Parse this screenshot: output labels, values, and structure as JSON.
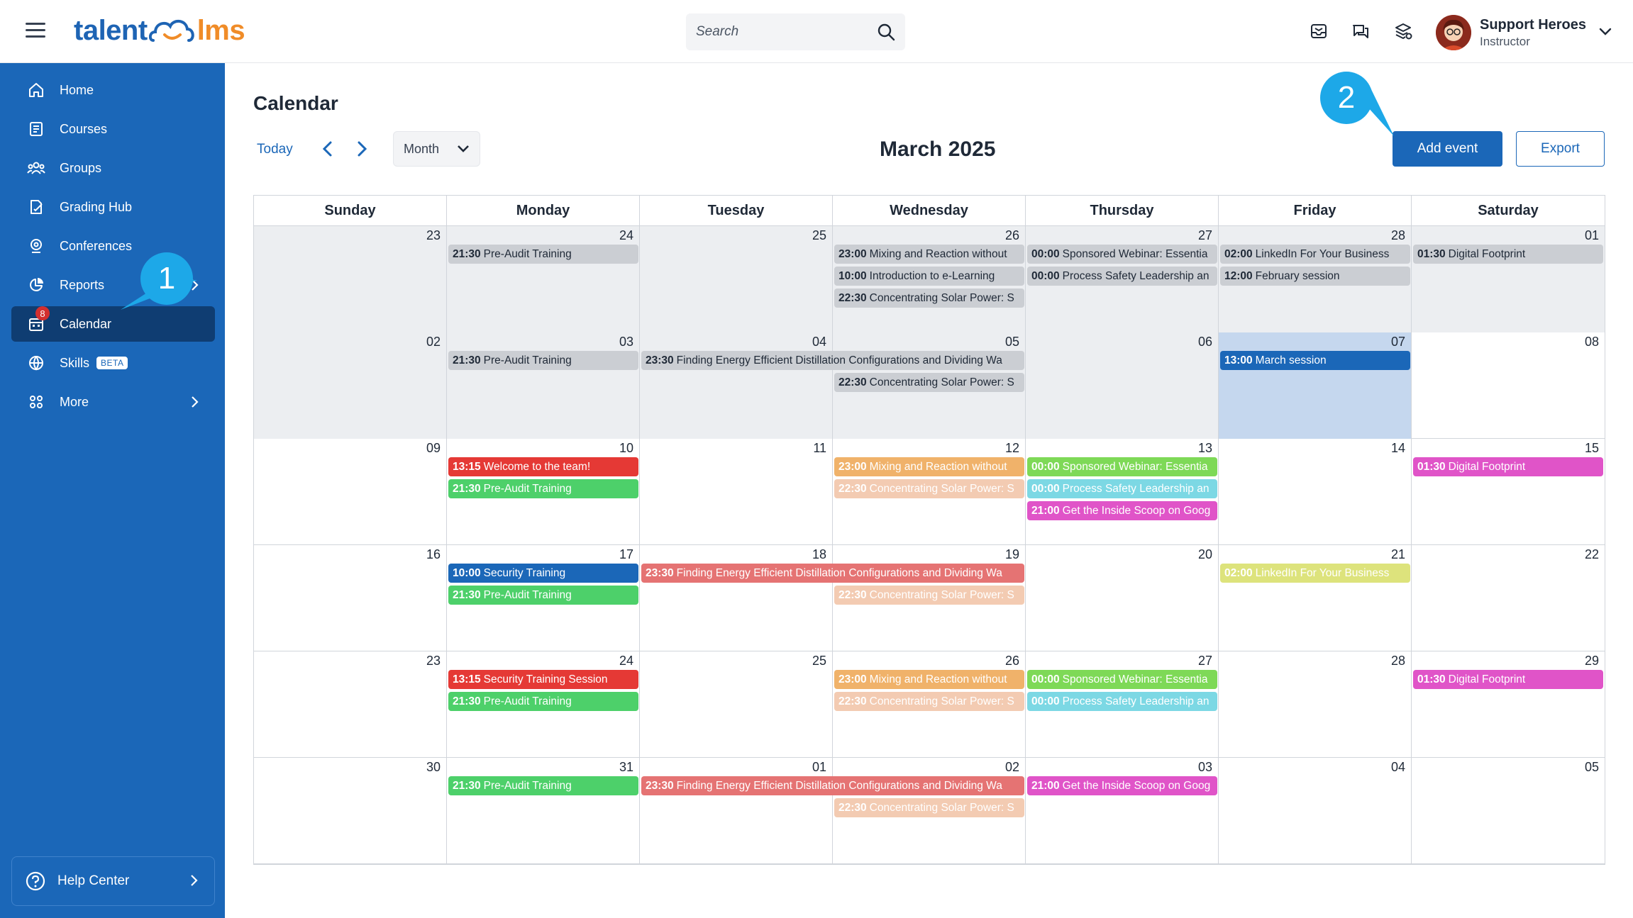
{
  "app": {
    "logo_part1": "talent",
    "logo_part2": "lms"
  },
  "search": {
    "placeholder": "Search"
  },
  "user": {
    "name": "Support Heroes",
    "role": "Instructor"
  },
  "sidebar": {
    "items": [
      {
        "label": "Home",
        "icon": "home-icon"
      },
      {
        "label": "Courses",
        "icon": "courses-icon"
      },
      {
        "label": "Groups",
        "icon": "groups-icon"
      },
      {
        "label": "Grading Hub",
        "icon": "grading-icon"
      },
      {
        "label": "Conferences",
        "icon": "conferences-icon"
      },
      {
        "label": "Reports",
        "icon": "reports-icon"
      },
      {
        "label": "Calendar",
        "icon": "calendar-icon",
        "badge": "8",
        "active": true
      },
      {
        "label": "Skills",
        "icon": "skills-icon",
        "tag": "BETA"
      },
      {
        "label": "More",
        "icon": "more-icon"
      }
    ],
    "help": "Help Center"
  },
  "main": {
    "title": "Calendar",
    "today": "Today",
    "view": "Month",
    "month": "March 2025",
    "add_event": "Add event",
    "export": "Export"
  },
  "calendar": {
    "weekdays": [
      "Sunday",
      "Monday",
      "Tuesday",
      "Wednesday",
      "Thursday",
      "Friday",
      "Saturday"
    ],
    "weeks": [
      [
        "23",
        "24",
        "25",
        "26",
        "27",
        "28",
        "01"
      ],
      [
        "02",
        "03",
        "04",
        "05",
        "06",
        "07",
        "08"
      ],
      [
        "09",
        "10",
        "11",
        "12",
        "13",
        "14",
        "15"
      ],
      [
        "16",
        "17",
        "18",
        "19",
        "20",
        "21",
        "22"
      ],
      [
        "23",
        "24",
        "25",
        "26",
        "27",
        "28",
        "29"
      ],
      [
        "30",
        "31",
        "01",
        "02",
        "03",
        "04",
        "05"
      ]
    ],
    "events": [
      {
        "w": 0,
        "d": 1,
        "s": 1,
        "r": 0,
        "c": "past",
        "time": "21:30",
        "title": "Pre-Audit Training"
      },
      {
        "w": 0,
        "d": 3,
        "s": 1,
        "r": 0,
        "c": "past",
        "time": "23:00",
        "title": "Mixing and Reaction without"
      },
      {
        "w": 0,
        "d": 3,
        "s": 1,
        "r": 1,
        "c": "past",
        "time": "10:00",
        "title": "Introduction to e-Learning"
      },
      {
        "w": 0,
        "d": 3,
        "s": 1,
        "r": 2,
        "c": "past",
        "time": "22:30",
        "title": "Concentrating Solar Power: S"
      },
      {
        "w": 0,
        "d": 4,
        "s": 1,
        "r": 0,
        "c": "past",
        "time": "00:00",
        "title": "Sponsored Webinar: Essentia"
      },
      {
        "w": 0,
        "d": 4,
        "s": 1,
        "r": 1,
        "c": "past",
        "time": "00:00",
        "title": "Process Safety Leadership an"
      },
      {
        "w": 0,
        "d": 5,
        "s": 1,
        "r": 0,
        "c": "past",
        "time": "02:00",
        "title": "LinkedIn For Your Business"
      },
      {
        "w": 0,
        "d": 5,
        "s": 1,
        "r": 1,
        "c": "past",
        "time": "12:00",
        "title": "February session"
      },
      {
        "w": 0,
        "d": 6,
        "s": 1,
        "r": 0,
        "c": "past",
        "time": "01:30",
        "title": "Digital Footprint"
      },
      {
        "w": 1,
        "d": 1,
        "s": 1,
        "r": 0,
        "c": "past",
        "time": "21:30",
        "title": "Pre-Audit Training"
      },
      {
        "w": 1,
        "d": 2,
        "s": 2,
        "r": 0,
        "c": "past",
        "time": "23:30",
        "title": "Finding Energy Efficient Distillation Configurations and Dividing Wa"
      },
      {
        "w": 1,
        "d": 3,
        "s": 1,
        "r": 1,
        "c": "past",
        "time": "22:30",
        "title": "Concentrating Solar Power: S"
      },
      {
        "w": 1,
        "d": 5,
        "s": 1,
        "r": 0,
        "c": "blue",
        "time": "13:00",
        "title": "March session"
      },
      {
        "w": 2,
        "d": 1,
        "s": 1,
        "r": 0,
        "c": "red",
        "time": "13:15",
        "title": "Welcome to the team!"
      },
      {
        "w": 2,
        "d": 1,
        "s": 1,
        "r": 1,
        "c": "green",
        "time": "21:30",
        "title": "Pre-Audit Training"
      },
      {
        "w": 2,
        "d": 3,
        "s": 1,
        "r": 0,
        "c": "orange",
        "time": "23:00",
        "title": "Mixing and Reaction without"
      },
      {
        "w": 2,
        "d": 3,
        "s": 1,
        "r": 1,
        "c": "peach",
        "time": "22:30",
        "title": "Concentrating Solar Power: S"
      },
      {
        "w": 2,
        "d": 4,
        "s": 1,
        "r": 0,
        "c": "lime",
        "time": "00:00",
        "title": "Sponsored Webinar: Essentia"
      },
      {
        "w": 2,
        "d": 4,
        "s": 1,
        "r": 1,
        "c": "cyan",
        "time": "00:00",
        "title": "Process Safety Leadership an"
      },
      {
        "w": 2,
        "d": 4,
        "s": 1,
        "r": 2,
        "c": "magenta",
        "time": "21:00",
        "title": "Get the Inside Scoop on Goog"
      },
      {
        "w": 2,
        "d": 6,
        "s": 1,
        "r": 0,
        "c": "magenta",
        "time": "01:30",
        "title": "Digital Footprint"
      },
      {
        "w": 3,
        "d": 1,
        "s": 1,
        "r": 0,
        "c": "blue",
        "time": "10:00",
        "title": "Security Training"
      },
      {
        "w": 3,
        "d": 1,
        "s": 1,
        "r": 1,
        "c": "green",
        "time": "21:30",
        "title": "Pre-Audit Training"
      },
      {
        "w": 3,
        "d": 2,
        "s": 2,
        "r": 0,
        "c": "salmon",
        "time": "23:30",
        "title": "Finding Energy Efficient Distillation Configurations and Dividing Wa"
      },
      {
        "w": 3,
        "d": 3,
        "s": 1,
        "r": 1,
        "c": "peach",
        "time": "22:30",
        "title": "Concentrating Solar Power: S"
      },
      {
        "w": 3,
        "d": 5,
        "s": 1,
        "r": 0,
        "c": "yellow",
        "time": "02:00",
        "title": "LinkedIn For Your Business"
      },
      {
        "w": 4,
        "d": 1,
        "s": 1,
        "r": 0,
        "c": "red",
        "time": "13:15",
        "title": "Security Training Session"
      },
      {
        "w": 4,
        "d": 1,
        "s": 1,
        "r": 1,
        "c": "green",
        "time": "21:30",
        "title": "Pre-Audit Training"
      },
      {
        "w": 4,
        "d": 3,
        "s": 1,
        "r": 0,
        "c": "orange",
        "time": "23:00",
        "title": "Mixing and Reaction without"
      },
      {
        "w": 4,
        "d": 3,
        "s": 1,
        "r": 1,
        "c": "peach",
        "time": "22:30",
        "title": "Concentrating Solar Power: S"
      },
      {
        "w": 4,
        "d": 4,
        "s": 1,
        "r": 0,
        "c": "lime",
        "time": "00:00",
        "title": "Sponsored Webinar: Essentia"
      },
      {
        "w": 4,
        "d": 4,
        "s": 1,
        "r": 1,
        "c": "cyan",
        "time": "00:00",
        "title": "Process Safety Leadership an"
      },
      {
        "w": 4,
        "d": 6,
        "s": 1,
        "r": 0,
        "c": "magenta",
        "time": "01:30",
        "title": "Digital Footprint"
      },
      {
        "w": 5,
        "d": 1,
        "s": 1,
        "r": 0,
        "c": "green",
        "time": "21:30",
        "title": "Pre-Audit Training"
      },
      {
        "w": 5,
        "d": 2,
        "s": 2,
        "r": 0,
        "c": "salmon",
        "time": "23:30",
        "title": "Finding Energy Efficient Distillation Configurations and Dividing Wa"
      },
      {
        "w": 5,
        "d": 3,
        "s": 1,
        "r": 1,
        "c": "peach",
        "time": "22:30",
        "title": "Concentrating Solar Power: S"
      },
      {
        "w": 5,
        "d": 4,
        "s": 1,
        "r": 0,
        "c": "magenta",
        "time": "21:00",
        "title": "Get the Inside Scoop on Goog"
      }
    ]
  },
  "callouts": {
    "one": "1",
    "two": "2"
  },
  "colors": {
    "brand_blue": "#1b67b8",
    "brand_orange": "#f08c28",
    "callout": "#1da8e8"
  }
}
